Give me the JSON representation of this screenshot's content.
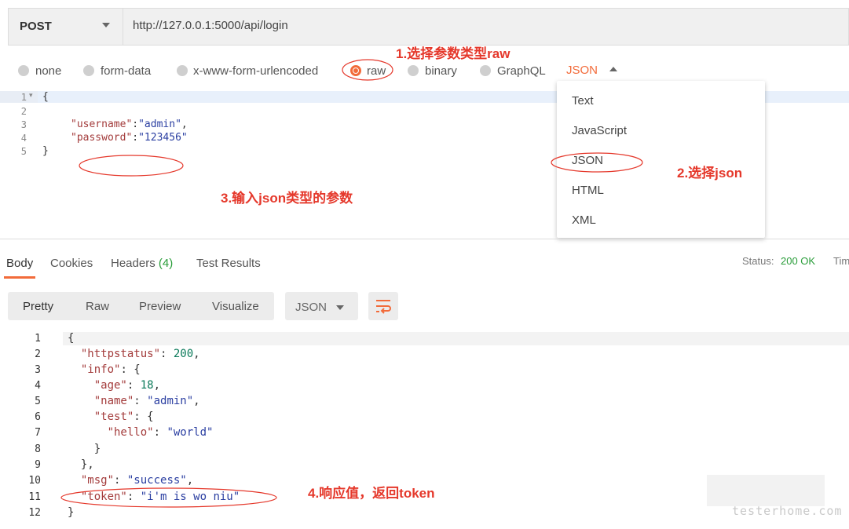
{
  "request": {
    "method": "POST",
    "url": "http://127.0.0.1:5000/api/login"
  },
  "body_types": [
    {
      "label": "none",
      "selected": false
    },
    {
      "label": "form-data",
      "selected": false
    },
    {
      "label": "x-www-form-urlencoded",
      "selected": false
    },
    {
      "label": "raw",
      "selected": true
    },
    {
      "label": "binary",
      "selected": false
    },
    {
      "label": "GraphQL",
      "selected": false
    }
  ],
  "raw_format": "JSON",
  "format_options": [
    "Text",
    "JavaScript",
    "JSON",
    "HTML",
    "XML"
  ],
  "request_editor": {
    "line_numbers": [
      "1",
      "2",
      "3",
      "4",
      "5"
    ],
    "open": "{",
    "l3_key": "\"username\"",
    "l3_val": "\"admin\"",
    "l4_key": "\"password\"",
    "l4_val": "\"123456\"",
    "close": "}"
  },
  "response_tabs": {
    "body": "Body",
    "cookies": "Cookies",
    "headers": "Headers",
    "headers_count": "(4)",
    "test_results": "Test Results"
  },
  "status": {
    "label": "Status:",
    "value": "200 OK",
    "time_label": "Tim"
  },
  "view_modes": [
    "Pretty",
    "Raw",
    "Preview",
    "Visualize"
  ],
  "response_format": "JSON",
  "response_lines": [
    "1",
    "2",
    "3",
    "4",
    "5",
    "6",
    "7",
    "8",
    "9",
    "10",
    "11",
    "12"
  ],
  "response": {
    "httpstatus_key": "\"httpstatus\"",
    "httpstatus_val": "200",
    "info_key": "\"info\"",
    "age_key": "\"age\"",
    "age_val": "18",
    "name_key": "\"name\"",
    "name_val": "\"admin\"",
    "test_key": "\"test\"",
    "hello_key": "\"hello\"",
    "hello_val": "\"world\"",
    "msg_key": "\"msg\"",
    "msg_val": "\"success\"",
    "token_key": "\"token\"",
    "token_val": "\"i'm is wo niu\""
  },
  "annotations": {
    "a1": "1.选择参数类型raw",
    "a2": "2.选择json",
    "a3": "3.输入json类型的参数",
    "a4": "4.响应值，返回token"
  },
  "watermark": "testerhome.com",
  "colors": {
    "accent": "#f26b3a",
    "annotation": "#e5382b",
    "status_ok": "#2a9d3a"
  }
}
